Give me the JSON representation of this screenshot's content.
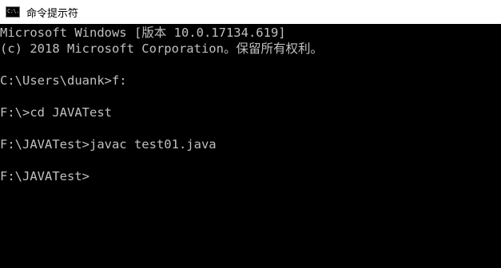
{
  "window": {
    "title": "命令提示符",
    "icon": "cmd-icon",
    "icon_text": "C:\\."
  },
  "console": {
    "background": "#000000",
    "foreground": "#c0c0c0",
    "lines": [
      "Microsoft Windows [版本 10.0.17134.619]",
      "(c) 2018 Microsoft Corporation。保留所有权利。",
      "",
      "C:\\Users\\duank>f:",
      "",
      "F:\\>cd JAVATest",
      "",
      "F:\\JAVATest>javac test01.java",
      "",
      "F:\\JAVATest>"
    ]
  }
}
